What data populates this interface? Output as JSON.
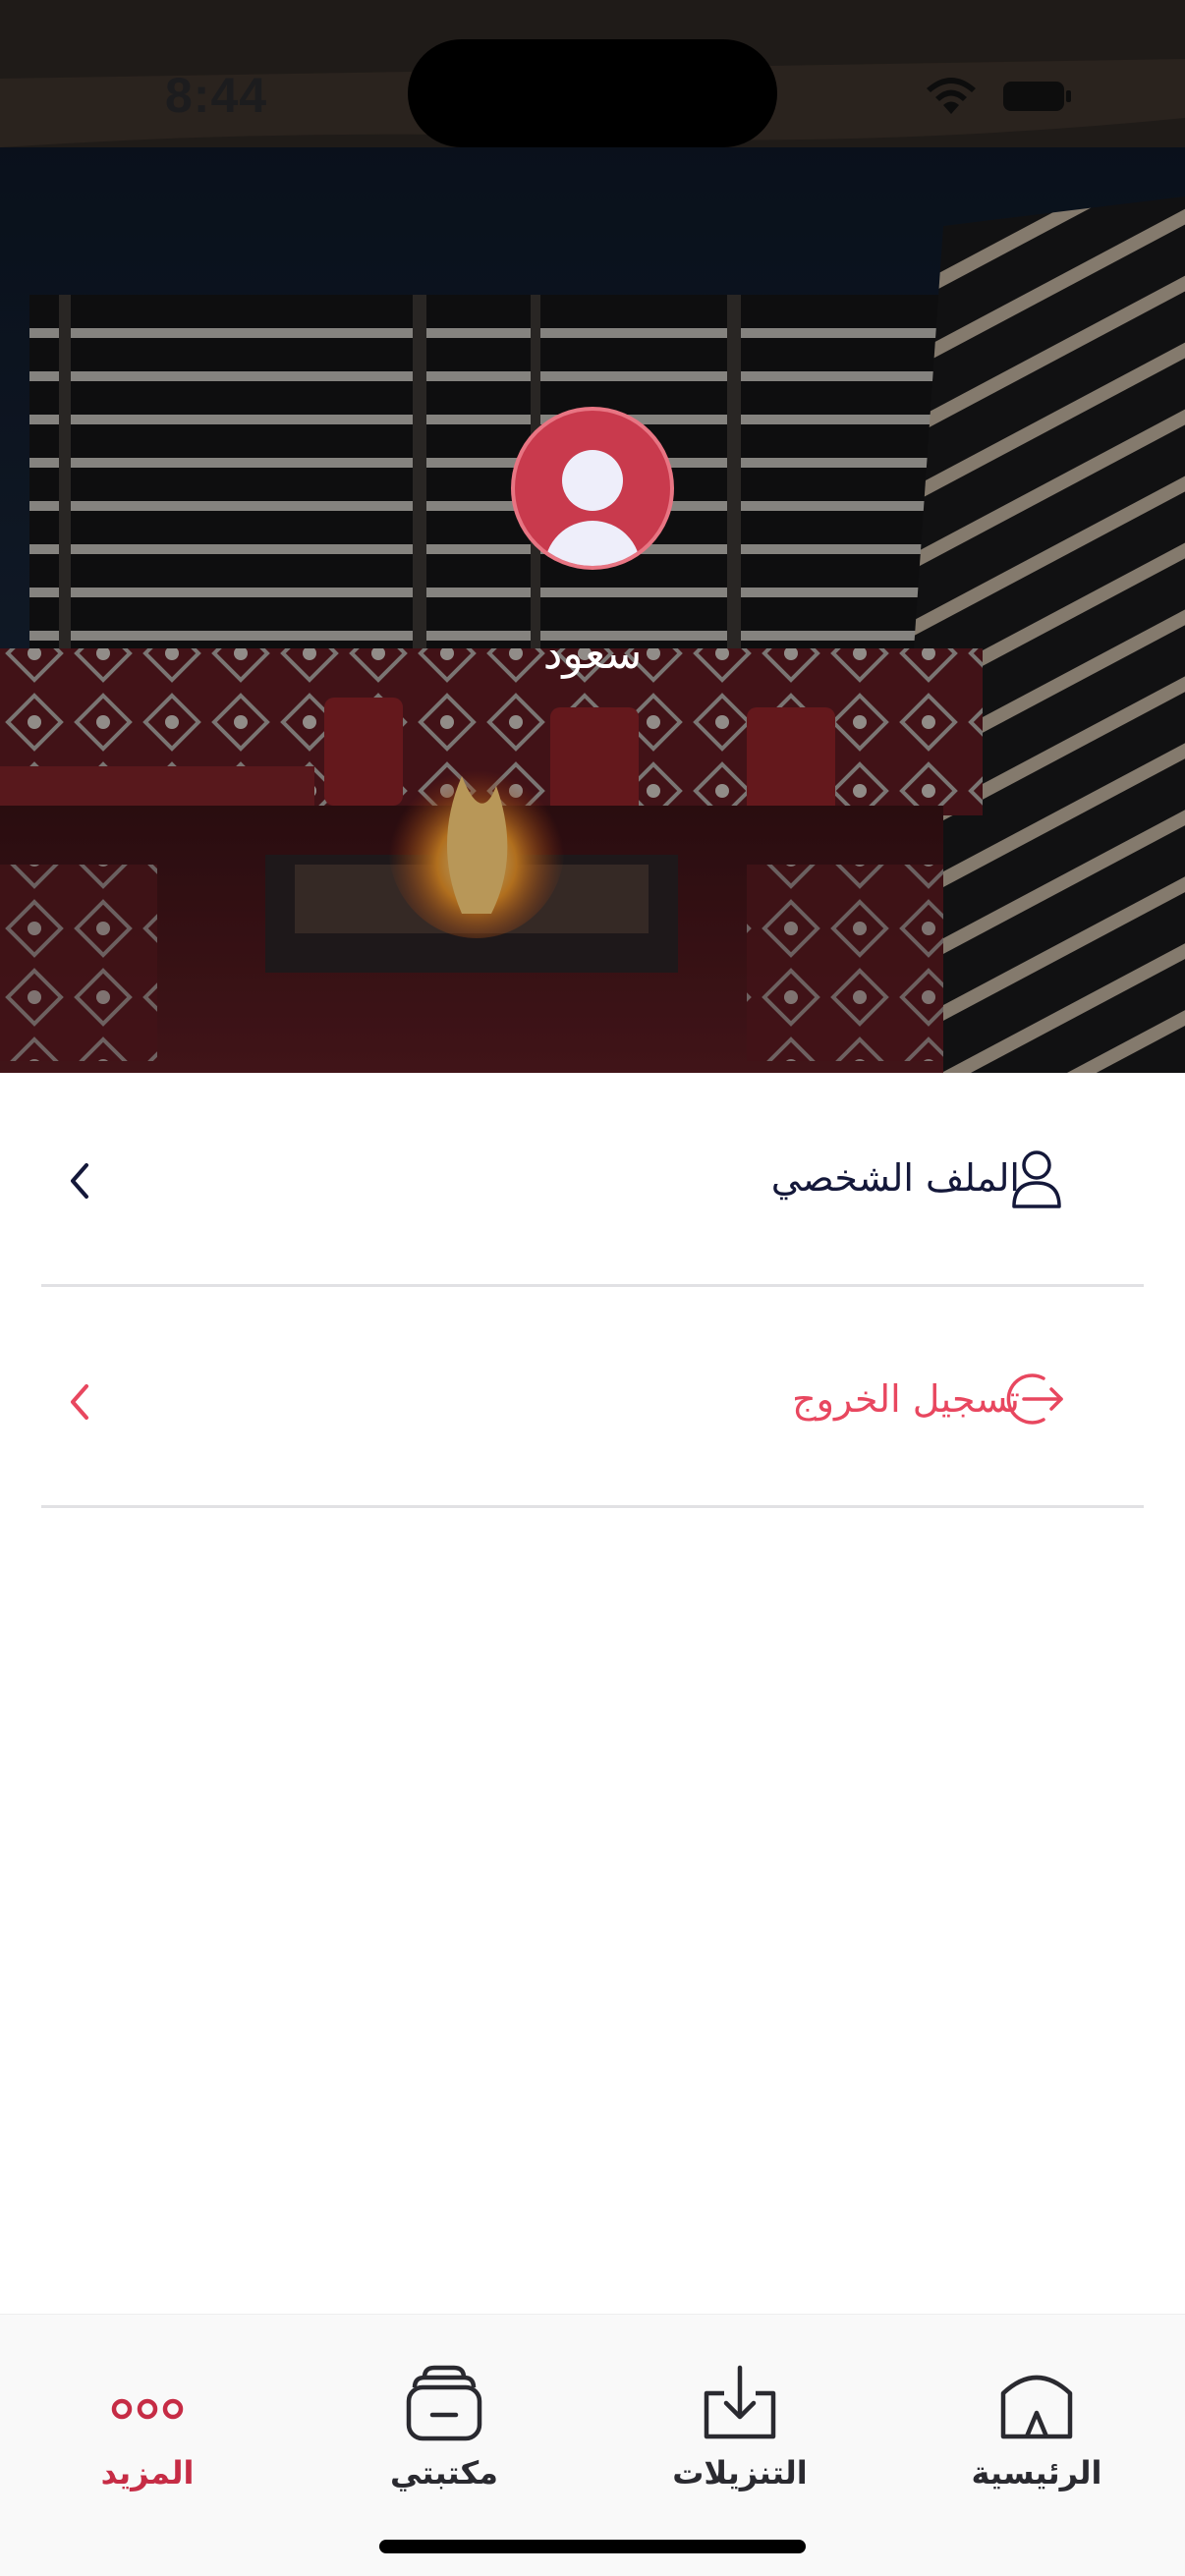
{
  "status_bar": {
    "time": "8:44"
  },
  "profile": {
    "name": "سعود"
  },
  "menu": {
    "items": [
      {
        "label": "الملف الشخصي",
        "icon": "user-icon",
        "style": "default"
      },
      {
        "label": "تسجيل الخروج",
        "icon": "logout-icon",
        "style": "danger"
      }
    ]
  },
  "tab_bar": {
    "tabs": [
      {
        "label": "الرئيسية",
        "icon": "tent-home-icon",
        "active": false
      },
      {
        "label": "التنزيلات",
        "icon": "download-tray-icon",
        "active": false
      },
      {
        "label": "مكتبتي",
        "icon": "library-basket-icon",
        "active": false
      },
      {
        "label": "المزيد",
        "icon": "more-dots-icon",
        "active": true
      }
    ]
  },
  "colors": {
    "accent": "#c62c45",
    "danger": "#e8475f",
    "text": "#14183a",
    "divider": "#e1e1e4",
    "tabbar_bg": "#f9f9f9"
  }
}
